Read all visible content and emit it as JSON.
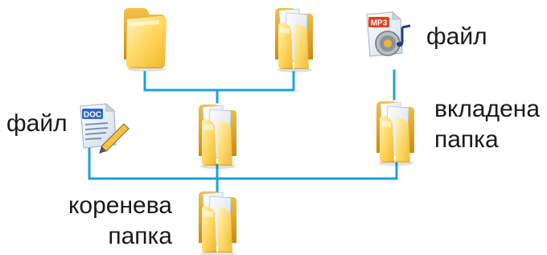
{
  "colors": {
    "connector": "#1aa3dc",
    "folder_back": "#e3a92b",
    "folder_front": "#ffd86a",
    "folder_front_light": "#fff1b5",
    "paper": "#dfe8f0",
    "mp3_badge": "#e0411c",
    "doc_badge": "#2f68c4"
  },
  "icons": {
    "top_left": "folder-closed-icon",
    "top_middle": "folder-open-icon",
    "top_right": "mp3-file-icon",
    "mid_left": "doc-file-icon",
    "mid_center": "folder-open-icon",
    "mid_right": "folder-open-icon",
    "root": "folder-open-icon"
  },
  "badges": {
    "mp3": "MP3",
    "doc": "DOC"
  },
  "labels": {
    "file_top": "файл",
    "file_left": "файл",
    "nested_folder_line1": "вкладена",
    "nested_folder_line2": "папка",
    "root_folder_line1": "коренева",
    "root_folder_line2": "папка"
  }
}
